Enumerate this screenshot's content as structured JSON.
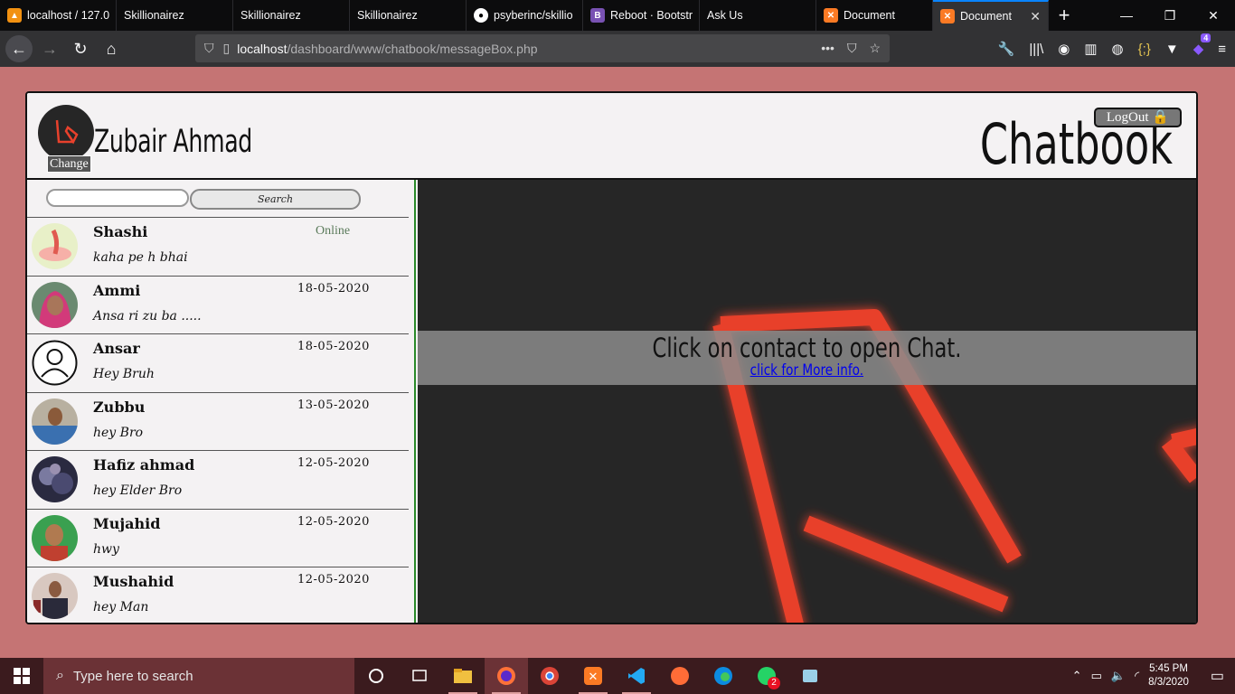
{
  "browser": {
    "tabs": [
      {
        "label": "localhost / 127.0",
        "icon": "phpmyadmin-icon",
        "color": "#f29111"
      },
      {
        "label": "Skillionairez",
        "icon": "",
        "color": ""
      },
      {
        "label": "Skillionairez",
        "icon": "",
        "color": ""
      },
      {
        "label": "Skillionairez",
        "icon": "",
        "color": ""
      },
      {
        "label": "psyberinc/skillio",
        "icon": "github-icon",
        "color": "#ffffff"
      },
      {
        "label": "Reboot · Bootstr",
        "icon": "bootstrap-icon",
        "color": "#7952b3"
      },
      {
        "label": "Ask Us",
        "icon": "",
        "color": ""
      },
      {
        "label": "Document",
        "icon": "xampp-icon",
        "color": "#fb7a24"
      },
      {
        "label": "Document",
        "icon": "xampp-icon",
        "color": "#fb7a24"
      }
    ],
    "url_host": "localhost",
    "url_path": "/dashboard/www/chatbook/messageBox.php",
    "ext_badge": "4"
  },
  "header": {
    "user_name": "Zubair Ahmad",
    "change_label": "Change",
    "logout_label": "LogOut",
    "brand": "Chatbook"
  },
  "search": {
    "button_label": "Search",
    "value": ""
  },
  "contacts": [
    {
      "name": "Shashi",
      "message": "kaha pe h bhai",
      "status": "Online",
      "date": ""
    },
    {
      "name": "Ammi",
      "message": "Ansa ri zu ba .....",
      "status": "",
      "date": "18-05-2020"
    },
    {
      "name": "Ansar",
      "message": "Hey Bruh",
      "status": "",
      "date": "18-05-2020"
    },
    {
      "name": "Zubbu",
      "message": "hey Bro",
      "status": "",
      "date": "13-05-2020"
    },
    {
      "name": "Hafiz ahmad",
      "message": "hey Elder Bro",
      "status": "",
      "date": "12-05-2020"
    },
    {
      "name": "Mujahid",
      "message": "hwy",
      "status": "",
      "date": "12-05-2020"
    },
    {
      "name": "Mushahid",
      "message": "hey Man",
      "status": "",
      "date": "12-05-2020"
    }
  ],
  "chat": {
    "prompt": "Click on contact to open Chat.",
    "link_label": "click for More info."
  },
  "taskbar": {
    "search_placeholder": "Type here to search",
    "time": "5:45 PM",
    "date": "8/3/2020",
    "whatsapp_badge": "2"
  },
  "colors": {
    "page_bg": "#c57474",
    "accent_red": "#e8412c",
    "link": "#0000ee"
  }
}
